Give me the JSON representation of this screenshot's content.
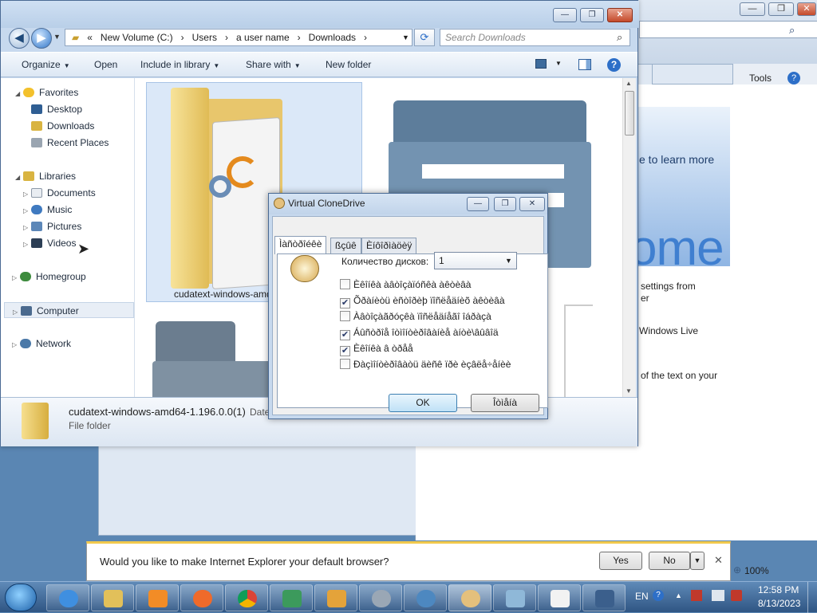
{
  "ie": {
    "tools_label": "Tools",
    "learn_more": "e to learn more",
    "big_text": "ome",
    "line1a": "settings from",
    "line1b": "er",
    "line2": "Windows Live",
    "line3": "of the text on your",
    "zoom": "100%"
  },
  "explorer": {
    "address": [
      "New Volume (C:)",
      "Users",
      "a user name",
      "Downloads"
    ],
    "search_placeholder": "Search Downloads",
    "toolbar": [
      "Organize",
      "Open",
      "Include in library",
      "Share with",
      "New folder"
    ],
    "nav": {
      "favorites": "Favorites",
      "desktop": "Desktop",
      "downloads": "Downloads",
      "recent": "Recent Places",
      "libraries": "Libraries",
      "documents": "Documents",
      "music": "Music",
      "pictures": "Pictures",
      "videos": "Videos",
      "homegroup": "Homegroup",
      "computer": "Computer",
      "network": "Network"
    },
    "file_label": "cudatext-windows-amd",
    "details_name": "cudatext-windows-amd64-1.196.0.0(1)",
    "details_date": "Date",
    "details_type": "File folder"
  },
  "dialog": {
    "title": "Virtual CloneDrive",
    "tabs": [
      "Ìàñòðîéêè",
      "ßçûê",
      "Èíôîðìàöèÿ"
    ],
    "drives_label": "Количество дисков:",
    "drives_value": "1",
    "options": [
      {
        "label": "Èêîíêà àâòîçàïóñêà àêòèâà",
        "checked": false
      },
      {
        "label": "Õðàíèòü èñòîðèþ ïîñëåäíèõ àêòèâà",
        "checked": true
      },
      {
        "label": "Àâòîçàãðóçêà ïîñëåäíåãî îáðàçà",
        "checked": false
      },
      {
        "label": "Áûñòðîå îòìîíòèðîâàíèå àíòè\\âûâîä",
        "checked": true
      },
      {
        "label": "Èêîíêà â òðåå",
        "checked": true
      },
      {
        "label": "Ðàçìîíòèðîâàòü äèñê ïðè èçâëå÷åíèè",
        "checked": false
      }
    ],
    "ok": "OK",
    "cancel": "Îòìåíà"
  },
  "notification": {
    "text": "Would you like to make Internet Explorer your default browser?",
    "yes": "Yes",
    "no": "No"
  },
  "taskbar": {
    "lang": "EN",
    "time": "12:58 PM",
    "date": "8/13/2023"
  }
}
